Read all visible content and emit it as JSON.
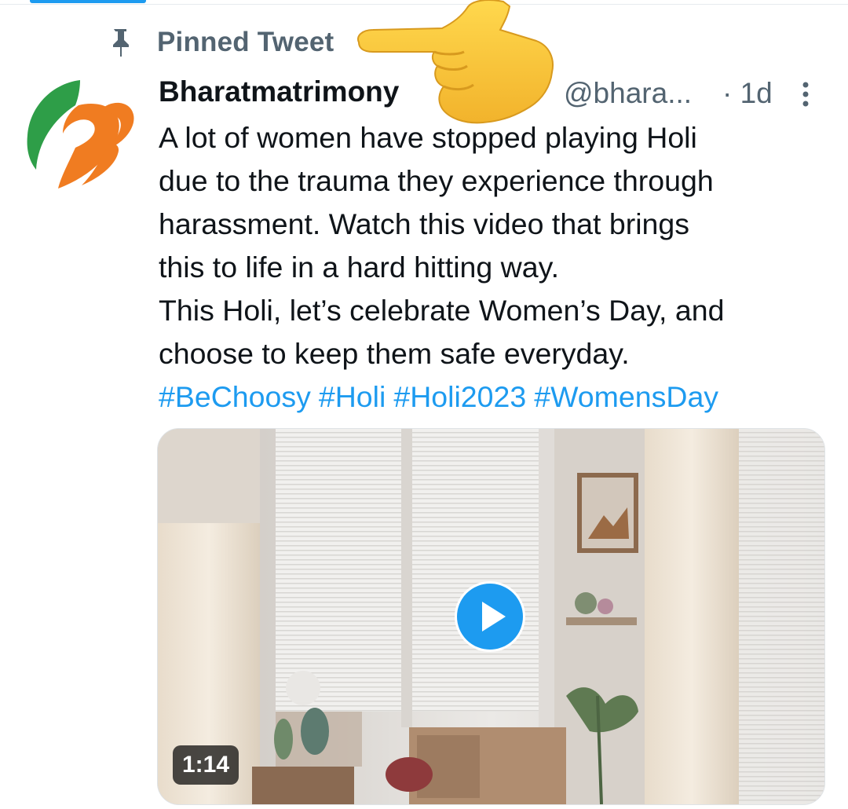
{
  "pinned": {
    "label": "Pinned Tweet",
    "icon": "pin-icon"
  },
  "tweet": {
    "display_name": "Bharatmatrimony",
    "handle": "@bhara...",
    "time": "· 1d",
    "text_lines": [
      "A lot of women have stopped playing Holi",
      "due to the trauma they experience through",
      "harassment. Watch this video that brings",
      "this to life in a hard hitting way.",
      "This Holi, let’s celebrate Women’s Day, and",
      "choose to keep them safe everyday."
    ],
    "hashtags": [
      "#BeChoosy",
      "#Holi",
      "#Holi2023",
      "#WomensDay"
    ]
  },
  "media": {
    "type": "video",
    "duration": "1:14",
    "play_icon": "play-icon"
  },
  "colors": {
    "link": "#1d9bf0",
    "secondary_text": "#536471",
    "primary_text": "#0f1419",
    "avatar_green": "#2e9e48",
    "avatar_orange": "#f07c21"
  },
  "overlay": {
    "icon": "pointing-hand-emoji"
  }
}
